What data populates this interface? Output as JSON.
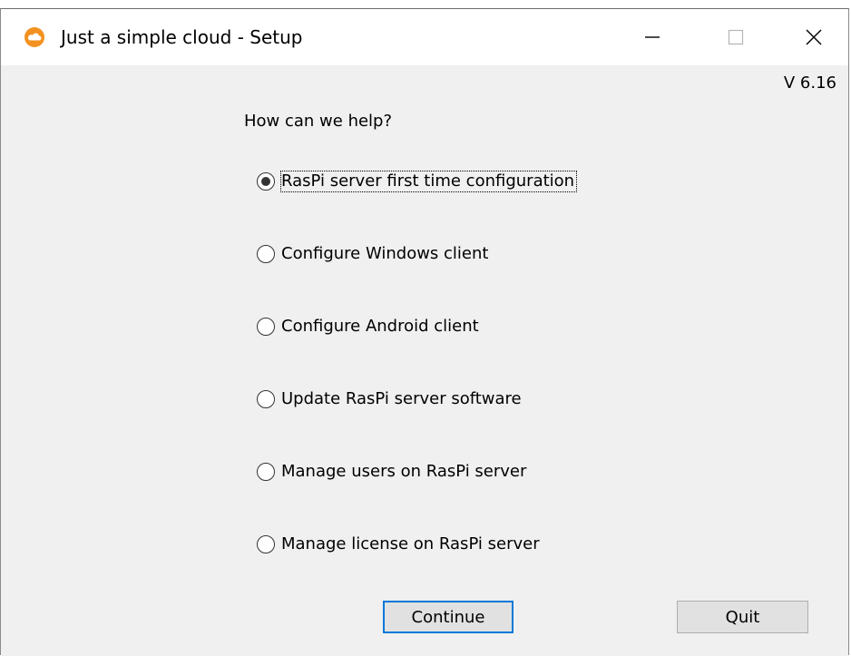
{
  "window": {
    "title": "Just a simple cloud - Setup",
    "app_icon": "cloud-icon",
    "controls": {
      "minimize_icon": "minimize-icon",
      "maximize_icon": "maximize-icon",
      "close_icon": "close-icon"
    }
  },
  "content": {
    "version": "V 6.16",
    "prompt": "How can we help?",
    "options": [
      {
        "label": "RasPi server first time configuration",
        "selected": true
      },
      {
        "label": "Configure Windows client",
        "selected": false
      },
      {
        "label": "Configure Android client",
        "selected": false
      },
      {
        "label": "Update RasPi server software",
        "selected": false
      },
      {
        "label": "Manage users on RasPi server",
        "selected": false
      },
      {
        "label": "Manage license on RasPi server",
        "selected": false
      }
    ],
    "buttons": {
      "continue_label": "Continue",
      "quit_label": "Quit"
    }
  },
  "colors": {
    "accent": "#0078d7",
    "icon_orange": "#f39221",
    "window_bg": "#f0f0f0"
  }
}
